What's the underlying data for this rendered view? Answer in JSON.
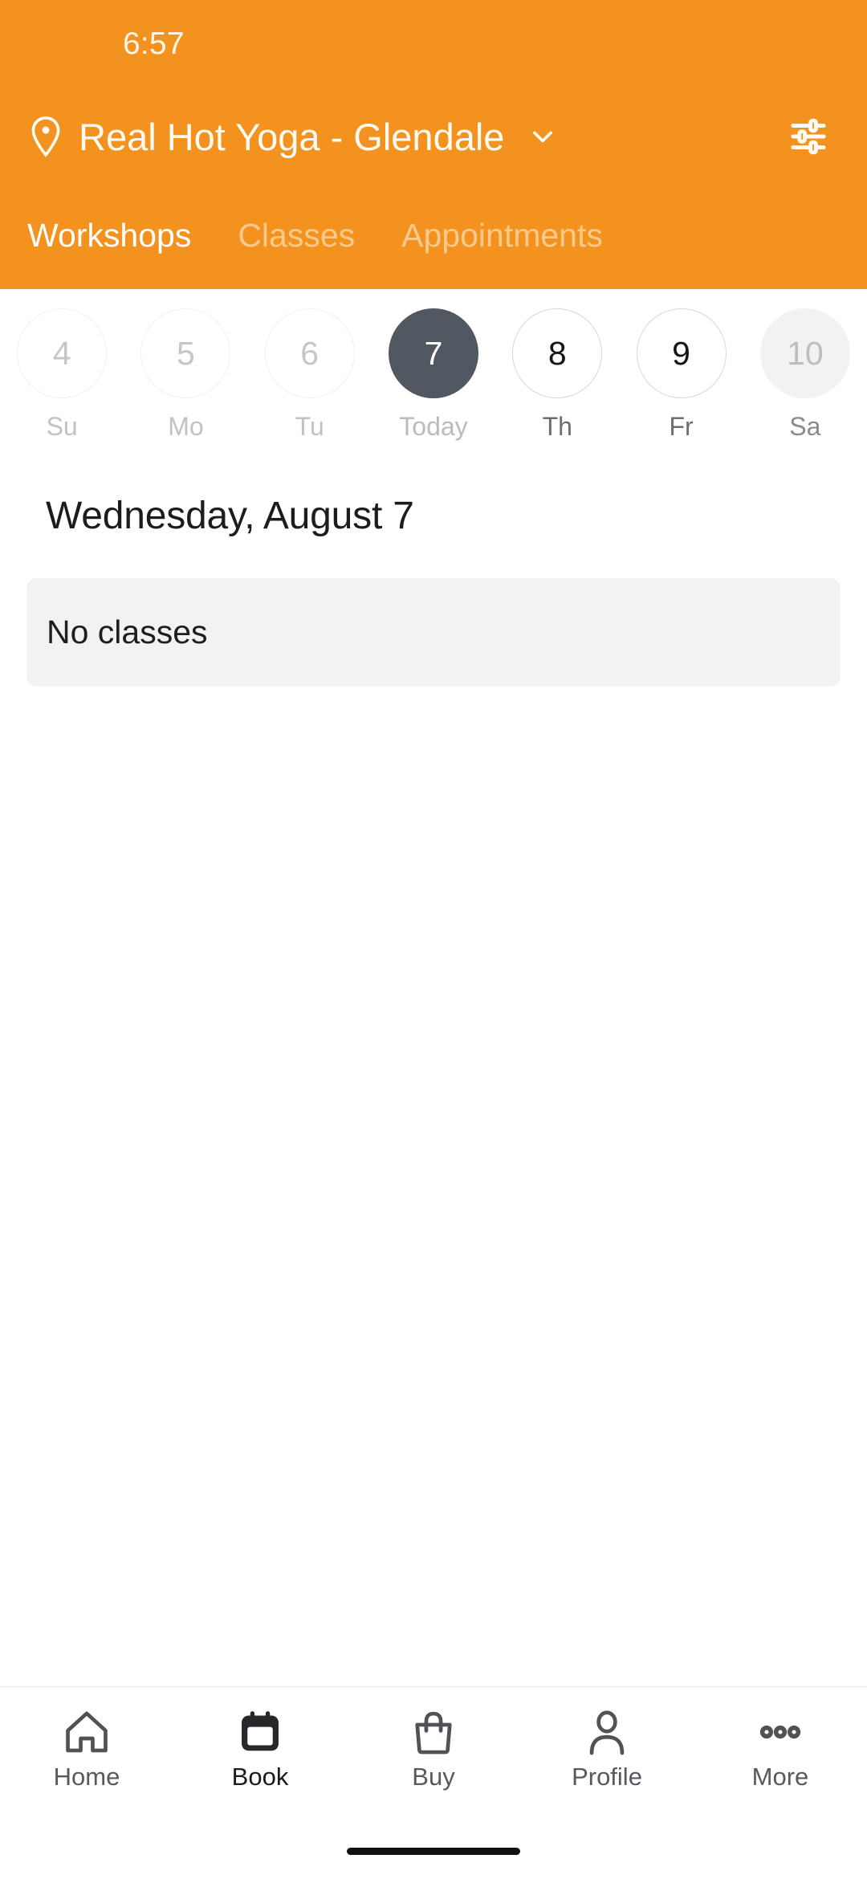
{
  "status_bar": {
    "time": "6:57"
  },
  "header": {
    "location_icon": "location-pin-icon",
    "location_name": "Real Hot Yoga - Glendale",
    "dropdown_icon": "chevron-down-icon",
    "filter_icon": "tune-filter-icon",
    "background_color": "#F3921E",
    "tabs": [
      {
        "label": "Workshops",
        "active": true
      },
      {
        "label": "Classes",
        "active": false
      },
      {
        "label": "Appointments",
        "active": false
      }
    ]
  },
  "date_strip": {
    "days": [
      {
        "num": "4",
        "label": "Su",
        "state": "past"
      },
      {
        "num": "5",
        "label": "Mo",
        "state": "past"
      },
      {
        "num": "6",
        "label": "Tu",
        "state": "past"
      },
      {
        "num": "7",
        "label": "Today",
        "state": "today"
      },
      {
        "num": "8",
        "label": "Th",
        "state": "future"
      },
      {
        "num": "9",
        "label": "Fr",
        "state": "future"
      },
      {
        "num": "10",
        "label": "Sa",
        "state": "last"
      }
    ],
    "selected_color": "#525862"
  },
  "main": {
    "date_title": "Wednesday, August 7",
    "empty_state": "No classes"
  },
  "bottom_nav": {
    "items": [
      {
        "label": "Home",
        "icon": "house-icon",
        "active": false
      },
      {
        "label": "Book",
        "icon": "calendar-icon",
        "active": true
      },
      {
        "label": "Buy",
        "icon": "shopping-bag-icon",
        "active": false
      },
      {
        "label": "Profile",
        "icon": "person-icon",
        "active": false
      },
      {
        "label": "More",
        "icon": "three-dots-icon",
        "active": false
      }
    ]
  }
}
